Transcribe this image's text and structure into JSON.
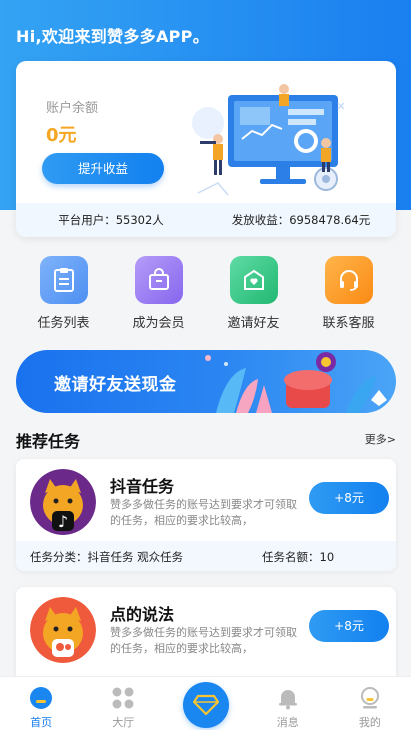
{
  "header": {
    "greeting": "Hi,欢迎来到赞多多APP。"
  },
  "balance": {
    "label": "账户余额",
    "value": "0元",
    "withdraw_button": "提升收益",
    "platform_users": "平台用户：55302人",
    "payout": "发放收益：6958478.64元"
  },
  "quick_actions": [
    {
      "label": "任务列表",
      "icon": "clipboard-icon",
      "color": "#5b9cf6"
    },
    {
      "label": "成为会员",
      "icon": "member-bag-icon",
      "color": "#9a7cf2"
    },
    {
      "label": "邀请好友",
      "icon": "invite-heart-icon",
      "color": "#35c98a"
    },
    {
      "label": "联系客服",
      "icon": "headset-icon",
      "color": "#fb9a2a"
    }
  ],
  "banner": {
    "text": "邀请好友送现金"
  },
  "recommend": {
    "title": "推荐任务",
    "more": "更多>"
  },
  "tasks": [
    {
      "name": "抖音任务",
      "desc": "赞多多做任务的账号达到要求才可领取的任务，相应的要求比较高，",
      "reward": "+8元",
      "category": "任务分类：抖音任务 观众任务",
      "quota": "任务名额：10"
    },
    {
      "name": "点的说法",
      "desc": "赞多多做任务的账号达到要求才可领取的任务，相应的要求比较高，",
      "reward": "+8元"
    }
  ],
  "tabbar": [
    {
      "label": "首页",
      "icon": "home-icon",
      "active": true
    },
    {
      "label": "大厅",
      "icon": "hall-grid-icon",
      "active": false
    },
    {
      "label": "",
      "icon": "diamond-icon",
      "active": false
    },
    {
      "label": "消息",
      "icon": "bell-icon",
      "active": false
    },
    {
      "label": "我的",
      "icon": "profile-icon",
      "active": false
    }
  ],
  "colors": {
    "primary": "#1a7ff0",
    "accent_orange": "#f5a623"
  }
}
